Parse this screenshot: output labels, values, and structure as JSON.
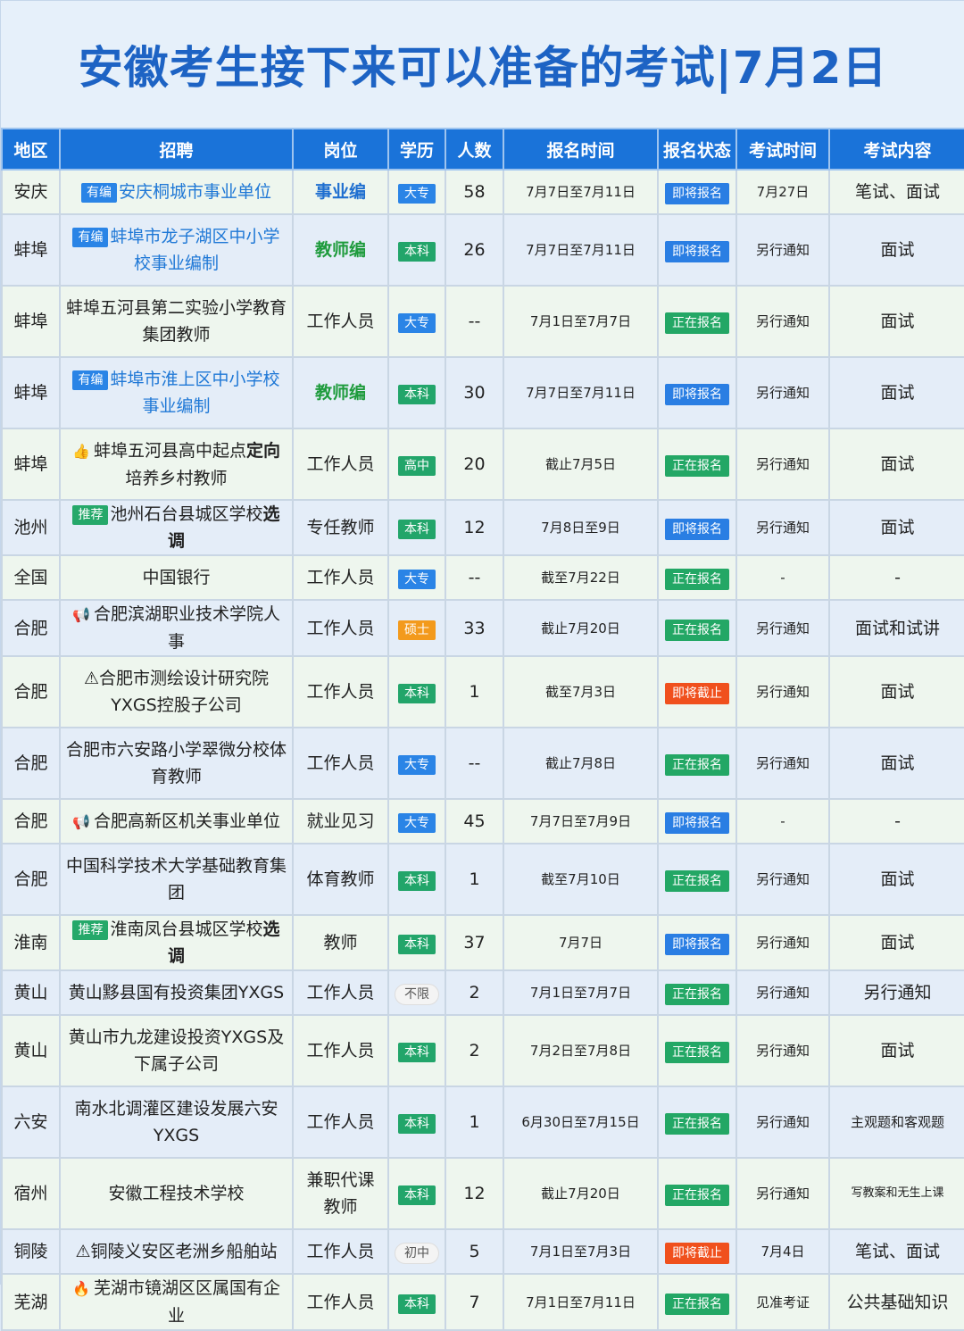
{
  "title": "安徽考生接下来可以准备的考试|7月2日",
  "headers": [
    "地区",
    "招聘",
    "岗位",
    "学历",
    "人数",
    "报名时间",
    "报名状态",
    "考试时间",
    "考试内容"
  ],
  "rows": [
    {
      "region": "安庆",
      "tag": "有编",
      "recruit": "安庆桐城市事业单位",
      "position": "事业编",
      "edu": "大专",
      "count": "58",
      "date": "7月7日至7月11日",
      "status": "即将报名",
      "exam": "7月27日",
      "content": "笔试、面试"
    },
    {
      "region": "蚌埠",
      "tag": "有编",
      "recruit": "蚌埠市龙子湖区中小学校事业编制",
      "position": "教师编",
      "edu": "本科",
      "count": "26",
      "date": "7月7日至7月11日",
      "status": "即将报名",
      "exam": "另行通知",
      "content": "面试"
    },
    {
      "region": "蚌埠",
      "recruit": "蚌埠五河县第二实验小学教育集团教师",
      "position": "工作人员",
      "edu": "大专",
      "count": "--",
      "date": "7月1日至7月7日",
      "status": "正在报名",
      "exam": "另行通知",
      "content": "面试"
    },
    {
      "region": "蚌埠",
      "tag": "有编",
      "recruit": "蚌埠市淮上区中小学校事业编制",
      "position": "教师编",
      "edu": "本科",
      "count": "30",
      "date": "7月7日至7月11日",
      "status": "即将报名",
      "exam": "另行通知",
      "content": "面试"
    },
    {
      "region": "蚌埠",
      "recruit_prefix": "蚌埠五河县高中起点",
      "recruit_bold": "定向",
      "recruit_suffix": "培养乡村教师",
      "position": "工作人员",
      "edu": "高中",
      "count": "20",
      "date": "截止7月5日",
      "status": "正在报名",
      "exam": "另行通知",
      "content": "面试"
    },
    {
      "region": "池州",
      "tag": "推荐",
      "recruit_prefix": "池州石台县城区学校",
      "recruit_bold": "选调",
      "position": "专任教师",
      "edu": "本科",
      "count": "12",
      "date": "7月8日至9日",
      "status": "即将报名",
      "exam": "另行通知",
      "content": "面试"
    },
    {
      "region": "全国",
      "recruit": "中国银行",
      "position": "工作人员",
      "edu": "大专",
      "count": "--",
      "date": "截至7月22日",
      "status": "正在报名",
      "exam": "-",
      "content": "-"
    },
    {
      "region": "合肥",
      "recruit": "合肥滨湖职业技术学院人事",
      "position": "工作人员",
      "edu": "硕士",
      "count": "33",
      "date": "截止7月20日",
      "status": "正在报名",
      "exam": "另行通知",
      "content": "面试和试讲"
    },
    {
      "region": "合肥",
      "recruit": "⚠合肥市测绘设计研究院YXGS控股子公司",
      "position": "工作人员",
      "edu": "本科",
      "count": "1",
      "date": "截至7月3日",
      "status": "即将截止",
      "exam": "另行通知",
      "content": "面试"
    },
    {
      "region": "合肥",
      "recruit": "合肥市六安路小学翠微分校体育教师",
      "position": "工作人员",
      "edu": "大专",
      "count": "--",
      "date": "截止7月8日",
      "status": "正在报名",
      "exam": "另行通知",
      "content": "面试"
    },
    {
      "region": "合肥",
      "recruit": "合肥高新区机关事业单位",
      "position": "就业见习",
      "edu": "大专",
      "count": "45",
      "date": "7月7日至7月9日",
      "status": "即将报名",
      "exam": "-",
      "content": "-"
    },
    {
      "region": "合肥",
      "recruit": "中国科学技术大学基础教育集团",
      "position": "体育教师",
      "edu": "本科",
      "count": "1",
      "date": "截至7月10日",
      "status": "正在报名",
      "exam": "另行通知",
      "content": "面试"
    },
    {
      "region": "淮南",
      "tag": "推荐",
      "recruit_prefix": "淮南凤台县城区学校",
      "recruit_bold": "选调",
      "position": "教师",
      "edu": "本科",
      "count": "37",
      "date": "7月7日",
      "status": "即将报名",
      "exam": "另行通知",
      "content": "面试"
    },
    {
      "region": "黄山",
      "recruit": "黄山黟县国有投资集团YXGS",
      "position": "工作人员",
      "edu": "不限",
      "count": "2",
      "date": "7月1日至7月7日",
      "status": "正在报名",
      "exam": "另行通知",
      "content": "另行通知"
    },
    {
      "region": "黄山",
      "recruit": "黄山市九龙建设投资YXGS及下属子公司",
      "position": "工作人员",
      "edu": "本科",
      "count": "2",
      "date": "7月2日至7月8日",
      "status": "正在报名",
      "exam": "另行通知",
      "content": "面试"
    },
    {
      "region": "六安",
      "recruit": "南水北调灌区建设发展六安YXGS",
      "position": "工作人员",
      "edu": "本科",
      "count": "1",
      "date": "6月30日至7月15日",
      "status": "正在报名",
      "exam": "另行通知",
      "content": "主观题和客观题"
    },
    {
      "region": "宿州",
      "recruit": "安徽工程技术学校",
      "position": "兼职代课教师",
      "edu": "本科",
      "count": "12",
      "date": "截止7月20日",
      "status": "正在报名",
      "exam": "另行通知",
      "content": "写教案和无生上课"
    },
    {
      "region": "铜陵",
      "recruit": "⚠铜陵义安区老洲乡船舶站",
      "position": "工作人员",
      "edu": "初中",
      "count": "5",
      "date": "7月1日至7月3日",
      "status": "即将截止",
      "exam": "7月4日",
      "content": "笔试、面试"
    },
    {
      "region": "芜湖",
      "recruit": "芜湖市镜湖区区属国有企业",
      "position": "工作人员",
      "edu": "本科",
      "count": "7",
      "date": "7月1日至7月11日",
      "status": "正在报名",
      "exam": "见准考证",
      "content": "公共基础知识"
    }
  ],
  "colors": {
    "header": "#1a73d9",
    "title": "#1d63c4",
    "status_blue": "#2a7ee3",
    "status_green": "#23a765",
    "status_red": "#f0501d"
  }
}
